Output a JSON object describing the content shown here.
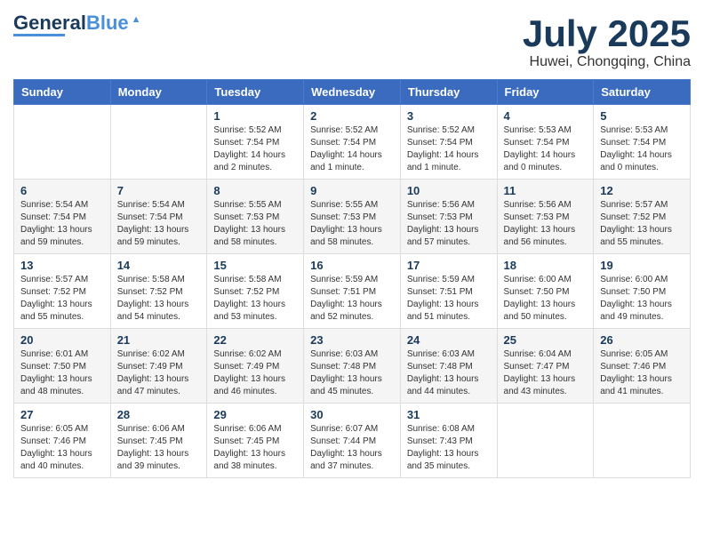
{
  "header": {
    "logo_general": "General",
    "logo_blue": "Blue",
    "month": "July 2025",
    "location": "Huwei, Chongqing, China"
  },
  "days_of_week": [
    "Sunday",
    "Monday",
    "Tuesday",
    "Wednesday",
    "Thursday",
    "Friday",
    "Saturday"
  ],
  "weeks": [
    [
      {
        "day": "",
        "content": ""
      },
      {
        "day": "",
        "content": ""
      },
      {
        "day": "1",
        "content": "Sunrise: 5:52 AM\nSunset: 7:54 PM\nDaylight: 14 hours\nand 2 minutes."
      },
      {
        "day": "2",
        "content": "Sunrise: 5:52 AM\nSunset: 7:54 PM\nDaylight: 14 hours\nand 1 minute."
      },
      {
        "day": "3",
        "content": "Sunrise: 5:52 AM\nSunset: 7:54 PM\nDaylight: 14 hours\nand 1 minute."
      },
      {
        "day": "4",
        "content": "Sunrise: 5:53 AM\nSunset: 7:54 PM\nDaylight: 14 hours\nand 0 minutes."
      },
      {
        "day": "5",
        "content": "Sunrise: 5:53 AM\nSunset: 7:54 PM\nDaylight: 14 hours\nand 0 minutes."
      }
    ],
    [
      {
        "day": "6",
        "content": "Sunrise: 5:54 AM\nSunset: 7:54 PM\nDaylight: 13 hours\nand 59 minutes."
      },
      {
        "day": "7",
        "content": "Sunrise: 5:54 AM\nSunset: 7:54 PM\nDaylight: 13 hours\nand 59 minutes."
      },
      {
        "day": "8",
        "content": "Sunrise: 5:55 AM\nSunset: 7:53 PM\nDaylight: 13 hours\nand 58 minutes."
      },
      {
        "day": "9",
        "content": "Sunrise: 5:55 AM\nSunset: 7:53 PM\nDaylight: 13 hours\nand 58 minutes."
      },
      {
        "day": "10",
        "content": "Sunrise: 5:56 AM\nSunset: 7:53 PM\nDaylight: 13 hours\nand 57 minutes."
      },
      {
        "day": "11",
        "content": "Sunrise: 5:56 AM\nSunset: 7:53 PM\nDaylight: 13 hours\nand 56 minutes."
      },
      {
        "day": "12",
        "content": "Sunrise: 5:57 AM\nSunset: 7:52 PM\nDaylight: 13 hours\nand 55 minutes."
      }
    ],
    [
      {
        "day": "13",
        "content": "Sunrise: 5:57 AM\nSunset: 7:52 PM\nDaylight: 13 hours\nand 55 minutes."
      },
      {
        "day": "14",
        "content": "Sunrise: 5:58 AM\nSunset: 7:52 PM\nDaylight: 13 hours\nand 54 minutes."
      },
      {
        "day": "15",
        "content": "Sunrise: 5:58 AM\nSunset: 7:52 PM\nDaylight: 13 hours\nand 53 minutes."
      },
      {
        "day": "16",
        "content": "Sunrise: 5:59 AM\nSunset: 7:51 PM\nDaylight: 13 hours\nand 52 minutes."
      },
      {
        "day": "17",
        "content": "Sunrise: 5:59 AM\nSunset: 7:51 PM\nDaylight: 13 hours\nand 51 minutes."
      },
      {
        "day": "18",
        "content": "Sunrise: 6:00 AM\nSunset: 7:50 PM\nDaylight: 13 hours\nand 50 minutes."
      },
      {
        "day": "19",
        "content": "Sunrise: 6:00 AM\nSunset: 7:50 PM\nDaylight: 13 hours\nand 49 minutes."
      }
    ],
    [
      {
        "day": "20",
        "content": "Sunrise: 6:01 AM\nSunset: 7:50 PM\nDaylight: 13 hours\nand 48 minutes."
      },
      {
        "day": "21",
        "content": "Sunrise: 6:02 AM\nSunset: 7:49 PM\nDaylight: 13 hours\nand 47 minutes."
      },
      {
        "day": "22",
        "content": "Sunrise: 6:02 AM\nSunset: 7:49 PM\nDaylight: 13 hours\nand 46 minutes."
      },
      {
        "day": "23",
        "content": "Sunrise: 6:03 AM\nSunset: 7:48 PM\nDaylight: 13 hours\nand 45 minutes."
      },
      {
        "day": "24",
        "content": "Sunrise: 6:03 AM\nSunset: 7:48 PM\nDaylight: 13 hours\nand 44 minutes."
      },
      {
        "day": "25",
        "content": "Sunrise: 6:04 AM\nSunset: 7:47 PM\nDaylight: 13 hours\nand 43 minutes."
      },
      {
        "day": "26",
        "content": "Sunrise: 6:05 AM\nSunset: 7:46 PM\nDaylight: 13 hours\nand 41 minutes."
      }
    ],
    [
      {
        "day": "27",
        "content": "Sunrise: 6:05 AM\nSunset: 7:46 PM\nDaylight: 13 hours\nand 40 minutes."
      },
      {
        "day": "28",
        "content": "Sunrise: 6:06 AM\nSunset: 7:45 PM\nDaylight: 13 hours\nand 39 minutes."
      },
      {
        "day": "29",
        "content": "Sunrise: 6:06 AM\nSunset: 7:45 PM\nDaylight: 13 hours\nand 38 minutes."
      },
      {
        "day": "30",
        "content": "Sunrise: 6:07 AM\nSunset: 7:44 PM\nDaylight: 13 hours\nand 37 minutes."
      },
      {
        "day": "31",
        "content": "Sunrise: 6:08 AM\nSunset: 7:43 PM\nDaylight: 13 hours\nand 35 minutes."
      },
      {
        "day": "",
        "content": ""
      },
      {
        "day": "",
        "content": ""
      }
    ]
  ]
}
